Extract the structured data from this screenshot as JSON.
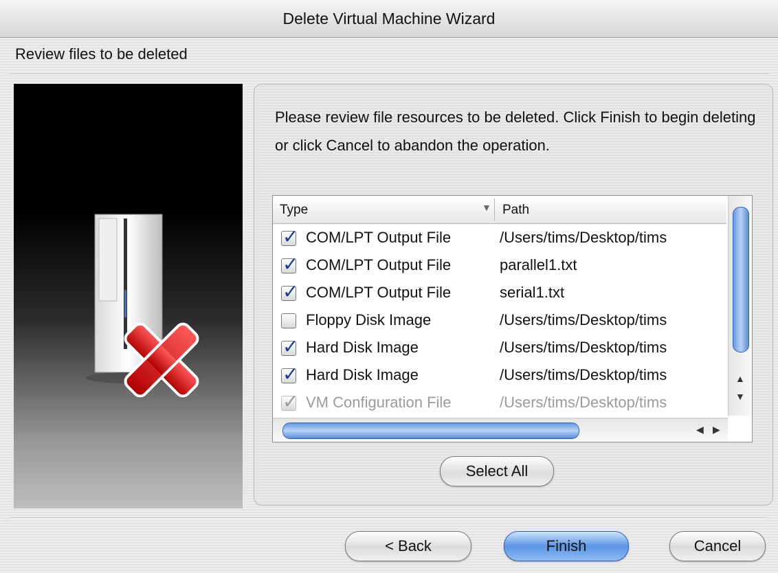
{
  "window": {
    "title": "Delete Virtual Machine Wizard"
  },
  "step": {
    "title": "Review files to be deleted"
  },
  "main": {
    "instructions": "Please review file resources to be deleted. Click Finish to begin deleting or click Cancel to abandon the operation."
  },
  "file_list": {
    "columns": {
      "type": "Type",
      "path": "Path"
    },
    "rows": [
      {
        "type": "COM/LPT Output File",
        "path": "/Users/tims/Desktop/tims",
        "checked": true,
        "enabled": true
      },
      {
        "type": "COM/LPT Output File",
        "path": "parallel1.txt",
        "checked": true,
        "enabled": true
      },
      {
        "type": "COM/LPT Output File",
        "path": "serial1.txt",
        "checked": true,
        "enabled": true
      },
      {
        "type": "Floppy Disk Image",
        "path": "/Users/tims/Desktop/tims",
        "checked": false,
        "enabled": true
      },
      {
        "type": "Hard Disk Image",
        "path": "/Users/tims/Desktop/tims",
        "checked": true,
        "enabled": true
      },
      {
        "type": "Hard Disk Image",
        "path": "/Users/tims/Desktop/tims",
        "checked": true,
        "enabled": true
      },
      {
        "type": "VM Configuration File",
        "path": "/Users/tims/Desktop/tims",
        "checked": true,
        "enabled": false
      }
    ]
  },
  "buttons": {
    "select_all": "Select All",
    "back": "< Back",
    "finish": "Finish",
    "cancel": "Cancel"
  },
  "colors": {
    "accent": "#3d7ad6",
    "check": "#1c3f9a"
  }
}
